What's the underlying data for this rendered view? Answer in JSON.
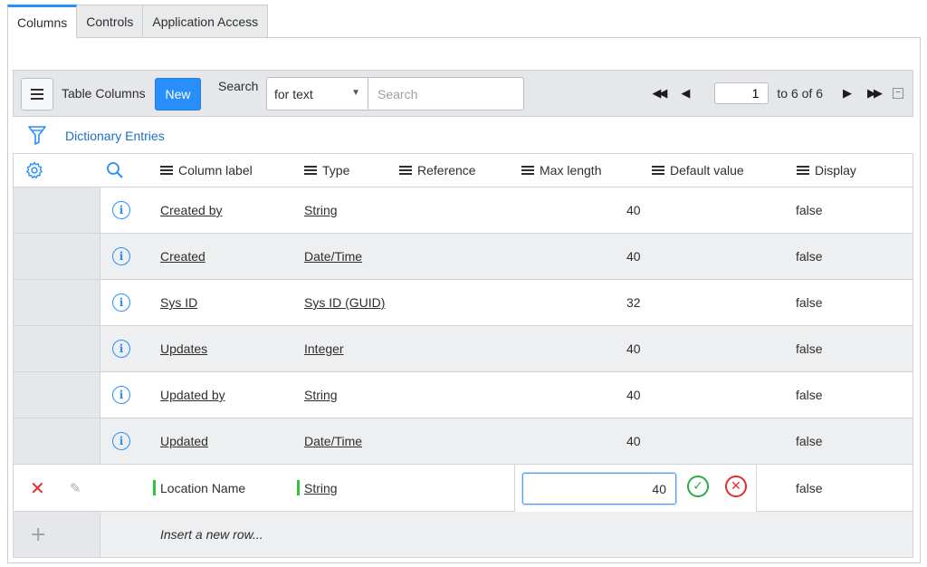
{
  "tabs": [
    {
      "label": "Columns",
      "active": true
    },
    {
      "label": "Controls",
      "active": false
    },
    {
      "label": "Application Access",
      "active": false
    }
  ],
  "toolbar": {
    "menu_icon": "hamburger-icon",
    "title": "Table Columns",
    "new_label": "New",
    "search_label": "Search",
    "search_field_value": "for text",
    "search_placeholder": "Search",
    "page_value": "1",
    "page_range": "to 6 of 6"
  },
  "filter": {
    "icon": "filter-funnel-icon",
    "link_label": "Dictionary Entries"
  },
  "table": {
    "headers": {
      "column_label": "Column label",
      "type": "Type",
      "reference": "Reference",
      "max_length": "Max length",
      "default_value": "Default value",
      "display": "Display"
    },
    "rows": [
      {
        "column_label": "Created by",
        "type": "String",
        "reference": "",
        "max_length": "40",
        "default_value": "",
        "display": "false"
      },
      {
        "column_label": "Created",
        "type": "Date/Time",
        "reference": "",
        "max_length": "40",
        "default_value": "",
        "display": "false"
      },
      {
        "column_label": "Sys ID",
        "type": "Sys ID (GUID)",
        "reference": "",
        "max_length": "32",
        "default_value": "",
        "display": "false"
      },
      {
        "column_label": "Updates",
        "type": "Integer",
        "reference": "",
        "max_length": "40",
        "default_value": "",
        "display": "false"
      },
      {
        "column_label": "Updated by",
        "type": "String",
        "reference": "",
        "max_length": "40",
        "default_value": "",
        "display": "false"
      },
      {
        "column_label": "Updated",
        "type": "Date/Time",
        "reference": "",
        "max_length": "40",
        "default_value": "",
        "display": "false"
      }
    ],
    "edit_row": {
      "column_label": "Location Name",
      "type": "String",
      "max_length_value": "40",
      "display": "false"
    },
    "insert_row_label": "Insert a new row..."
  },
  "colors": {
    "accent": "#278efc",
    "new_row_marker": "#2dc43e",
    "confirm": "#2dab47",
    "cancel": "#e22d2d"
  }
}
